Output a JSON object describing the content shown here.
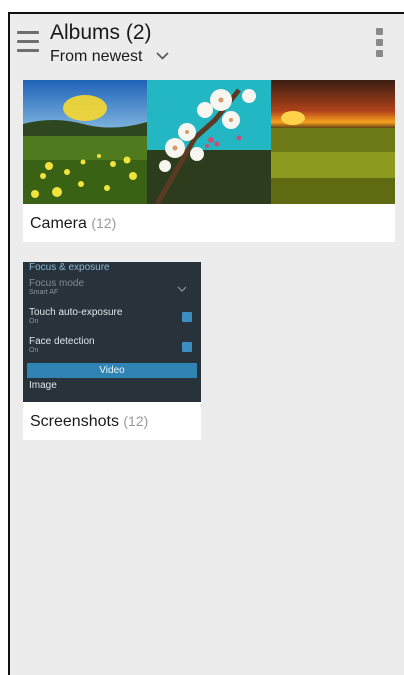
{
  "header": {
    "title": "Albums (2)",
    "sort_label": "From newest"
  },
  "albums": [
    {
      "name": "Camera",
      "count": "(12)"
    },
    {
      "name": "Screenshots",
      "count": "(12)"
    }
  ],
  "screenshot_preview": {
    "section_title": "Focus & exposure",
    "rows": [
      {
        "label": "Focus mode",
        "sub": "Smart AF"
      },
      {
        "label": "Touch auto-exposure",
        "sub": "On"
      },
      {
        "label": "Face detection",
        "sub": "On"
      }
    ],
    "video_label": "Video",
    "image_label": "Image"
  },
  "colors": {
    "background": "#ececec",
    "accent": "#2f84b3"
  }
}
